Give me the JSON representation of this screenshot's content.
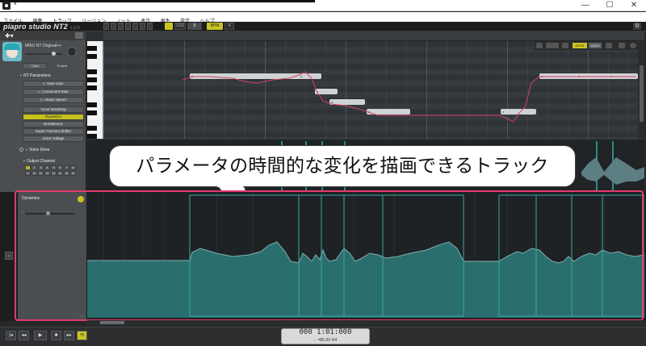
{
  "window": {
    "title": "*",
    "minimize": "—",
    "maximize": "☐",
    "close": "✕"
  },
  "menu": [
    "ファイル",
    "編集",
    "トラック",
    "リージョン",
    "ノート",
    "表示",
    "再生",
    "設定",
    "ヘルプ"
  ],
  "app": {
    "logo": "piapro studio NT2",
    "version": "1.0.0"
  },
  "header": {
    "snap_value": "1/16",
    "snap_sub": "8",
    "mode_label": "BPM",
    "mode_value": "4"
  },
  "singer": {
    "name": "MIKU NT Original++",
    "gain_label": "* Gain",
    "portal_label": "Portpst",
    "option_label": "✦ ⛶"
  },
  "nt_parameters": {
    "title": "NT Parameters",
    "items": [
      "L: Note Gain",
      "L: Consonant Rate",
      "L: Attack Speed"
    ]
  },
  "functions": {
    "items": [
      "Vocal Morphing",
      "Dynamics",
      "Breathiness",
      "Super Formant Shifter",
      "Voice Voltage"
    ],
    "active": "Dynamics"
  },
  "voice_drive": {
    "label": "Voice Drive"
  },
  "output_channel": {
    "title": "Output Channel",
    "channels": [
      "1",
      "2",
      "3",
      "4",
      "5",
      "6",
      "7",
      "8",
      "9",
      "10",
      "11",
      "12",
      "13",
      "14",
      "15",
      "16"
    ]
  },
  "roll_tools": {
    "yellow_label": "NOTE",
    "gray_label": "WAVE"
  },
  "notes": [
    {
      "label": "a"
    },
    {
      "label": "o"
    },
    {
      "label": "e"
    },
    {
      "label": "a"
    },
    {
      "label": "a"
    },
    {
      "label": "o"
    },
    {
      "label": "a"
    },
    {
      "label": "o"
    },
    {
      "label": "o"
    }
  ],
  "callout": {
    "text": "パラメータの時間的な変化を描画できるトラック"
  },
  "dynamics": {
    "title": "Dynamics",
    "expand_icon": "chevron-down-icon"
  },
  "transport": {
    "buttons": [
      "|◂",
      "◂◂",
      "▶",
      "■",
      "▸▸",
      "⟲"
    ],
    "time": "000 1:01:000",
    "tempo": "♩=80.00  4/4"
  }
}
